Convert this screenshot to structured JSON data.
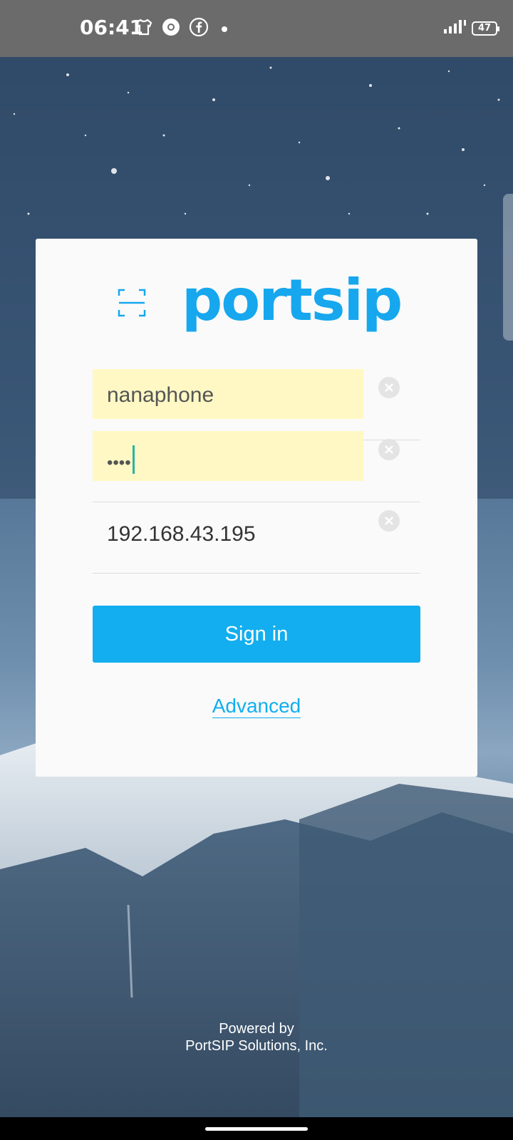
{
  "status_bar": {
    "time": "06:41",
    "icons": [
      "tshirt-icon",
      "chrome-icon",
      "facebook-icon",
      "dot-icon"
    ],
    "battery": "47",
    "signal_icon": "signal-icon"
  },
  "login": {
    "logo_text": "portsip",
    "scan_icon": "qr-scan-icon",
    "username": "nanaphone",
    "password_mask": "••••",
    "server": "192.168.43.195",
    "sign_in_label": "Sign in",
    "advanced_label": "Advanced"
  },
  "footer": {
    "line1": "Powered by",
    "line2": "PortSIP Solutions, Inc."
  },
  "colors": {
    "accent": "#12aeef",
    "autofill": "#fff8c4",
    "status_bar": "#6b6b6b"
  }
}
